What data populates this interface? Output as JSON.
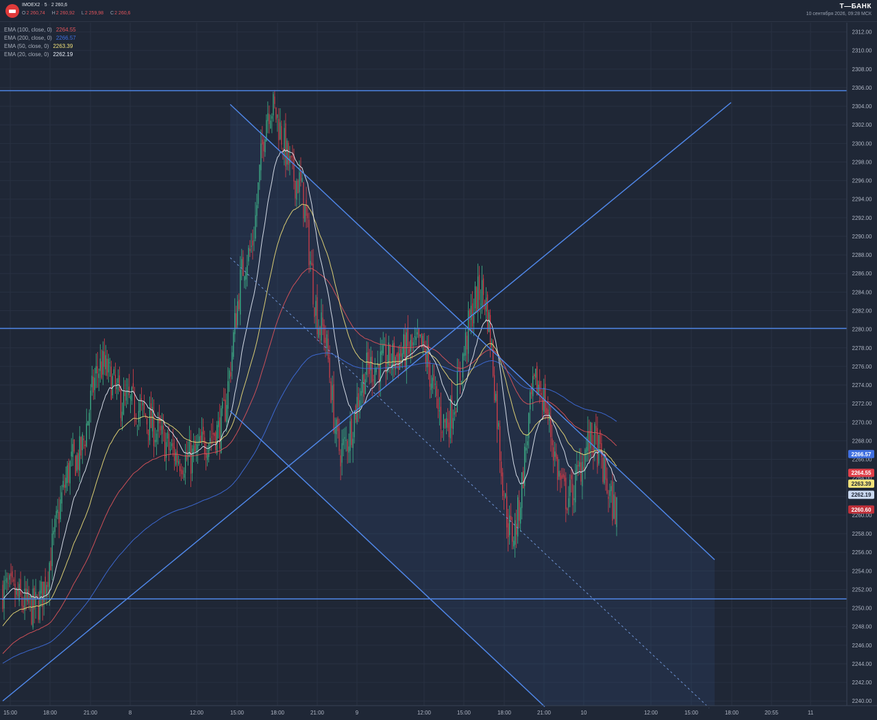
{
  "header": {
    "symbol": "IMOEX2",
    "interval": "5",
    "last_price": "2 260,6",
    "ohlc": [
      {
        "key": "O",
        "value": "2 260,74"
      },
      {
        "key": "H",
        "value": "2 260,92"
      },
      {
        "key": "L",
        "value": "2 259,98"
      },
      {
        "key": "C",
        "value": "2 260,6"
      }
    ],
    "brand": "Т—БАНК",
    "datetime": "10 сентября 2026, 09:28 МСК"
  },
  "legend": [
    {
      "label": "EMA (100, close, 0)",
      "value": "2264.55",
      "color": "#e0545b"
    },
    {
      "label": "EMA (200, close, 0)",
      "value": "2266.57",
      "color": "#3f6fe0"
    },
    {
      "label": "EMA (50, close, 0)",
      "value": "2263.39",
      "color": "#f0e07a"
    },
    {
      "label": "EMA (20, close, 0)",
      "value": "2262.19",
      "color": "#e8eef8"
    }
  ],
  "chart_data": {
    "type": "candlestick",
    "ylim": [
      2239.5,
      2313.0
    ],
    "y_ticks": [
      "2312.00",
      "2310.00",
      "2308.00",
      "2306.00",
      "2304.00",
      "2302.00",
      "2300.00",
      "2298.00",
      "2296.00",
      "2294.00",
      "2292.00",
      "2290.00",
      "2288.00",
      "2286.00",
      "2284.00",
      "2282.00",
      "2280.00",
      "2278.00",
      "2276.00",
      "2274.00",
      "2272.00",
      "2270.00",
      "2268.00",
      "2266.00",
      "2264.00",
      "2262.00",
      "2260.00",
      "2258.00",
      "2256.00",
      "2254.00",
      "2252.00",
      "2250.00",
      "2248.00",
      "2246.00",
      "2244.00",
      "2242.00",
      "2240.00"
    ],
    "x_ticks": [
      "15:00",
      "18:00",
      "21:00",
      "8",
      "12:00",
      "15:00",
      "18:00",
      "21:00",
      "9",
      "12:00",
      "15:00",
      "18:00",
      "21:00",
      "10",
      "12:00",
      "15:00",
      "18:00",
      "20:55",
      "11"
    ],
    "grid": true,
    "horizontal_levels": [
      {
        "value": 2305.67,
        "label": "2305.67"
      },
      {
        "value": 2280.09,
        "label": "2280.09"
      },
      {
        "value": 2250.98,
        "label": "2250.98"
      }
    ],
    "price_tags": [
      {
        "value": 2266.57,
        "label": "2266.57",
        "color": "#3f6fe0",
        "text": "#ffffff"
      },
      {
        "value": 2264.55,
        "label": "2264.55",
        "color": "#e0404a",
        "text": "#ffffff"
      },
      {
        "value": 2263.39,
        "label": "2263.39",
        "color": "#f0e07a",
        "text": "#1f2736"
      },
      {
        "value": 2262.19,
        "label": "2262.19",
        "color": "#c9d8f0",
        "text": "#1f2736"
      },
      {
        "value": 2260.6,
        "label": "2260.60",
        "color": "#c0303a",
        "text": "#ffffff"
      }
    ],
    "key_points": [
      {
        "t": 0,
        "close": 2252
      },
      {
        "t": 0.05,
        "close": 2250
      },
      {
        "t": 0.12,
        "close": 2266
      },
      {
        "t": 0.16,
        "close": 2276
      },
      {
        "t": 0.2,
        "close": 2272
      },
      {
        "t": 0.3,
        "close": 2266
      },
      {
        "t": 0.35,
        "close": 2269
      },
      {
        "t": 0.4,
        "close": 2288
      },
      {
        "t": 0.435,
        "close": 2304
      },
      {
        "t": 0.48,
        "close": 2296
      },
      {
        "t": 0.52,
        "close": 2280
      },
      {
        "t": 0.55,
        "close": 2267
      },
      {
        "t": 0.6,
        "close": 2276
      },
      {
        "t": 0.68,
        "close": 2278
      },
      {
        "t": 0.72,
        "close": 2270
      },
      {
        "t": 0.78,
        "close": 2284
      },
      {
        "t": 0.83,
        "close": 2258
      },
      {
        "t": 0.87,
        "close": 2274
      },
      {
        "t": 0.92,
        "close": 2262
      },
      {
        "t": 0.96,
        "close": 2268
      },
      {
        "t": 1.0,
        "close": 2260.6
      }
    ],
    "trend_lines": [
      {
        "from": {
          "t": "~15:00 Sep 8",
          "value": 2304.2
        },
        "to": {
          "t": "~15:00 Sep 10",
          "value": 2255.2
        }
      },
      {
        "from": {
          "t": "~15:00 Sep 8",
          "value": 2271.2
        },
        "to": {
          "t": "~21:00 Sep 9",
          "value": 2239.2
        }
      },
      {
        "from": {
          "t": "start",
          "value": 2240.0
        },
        "to": {
          "t": "~18:00 Sep 10",
          "value": 2304.4
        }
      }
    ]
  }
}
